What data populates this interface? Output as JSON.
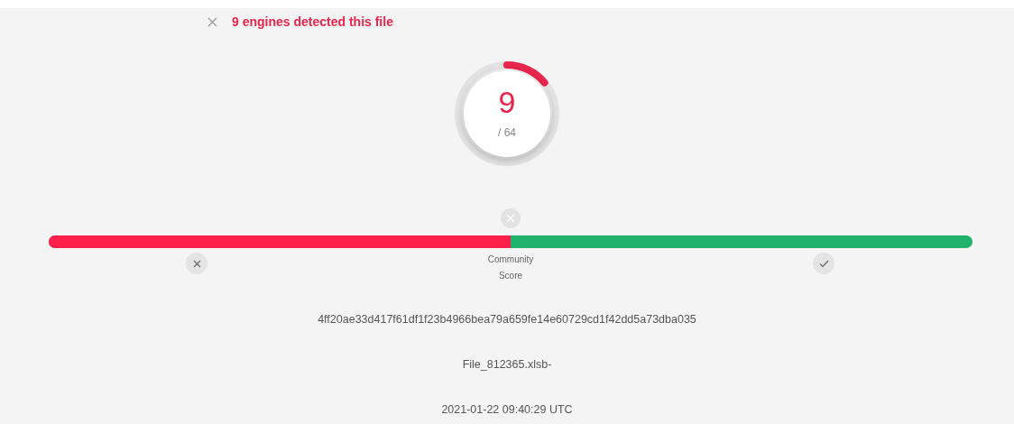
{
  "header": {
    "title": "9 engines detected this file"
  },
  "detection": {
    "count": "9",
    "total": "/ 64"
  },
  "community": {
    "label": "Community Score",
    "level": 0.5
  },
  "file": {
    "hash": "4ff20ae33d417f61df1f23b4966bea79a659fe14e60729cd1f42dd5a73dba035",
    "name": "File_812365.xlsb-",
    "date": "2021-01-22 09:40:29 UTC"
  }
}
